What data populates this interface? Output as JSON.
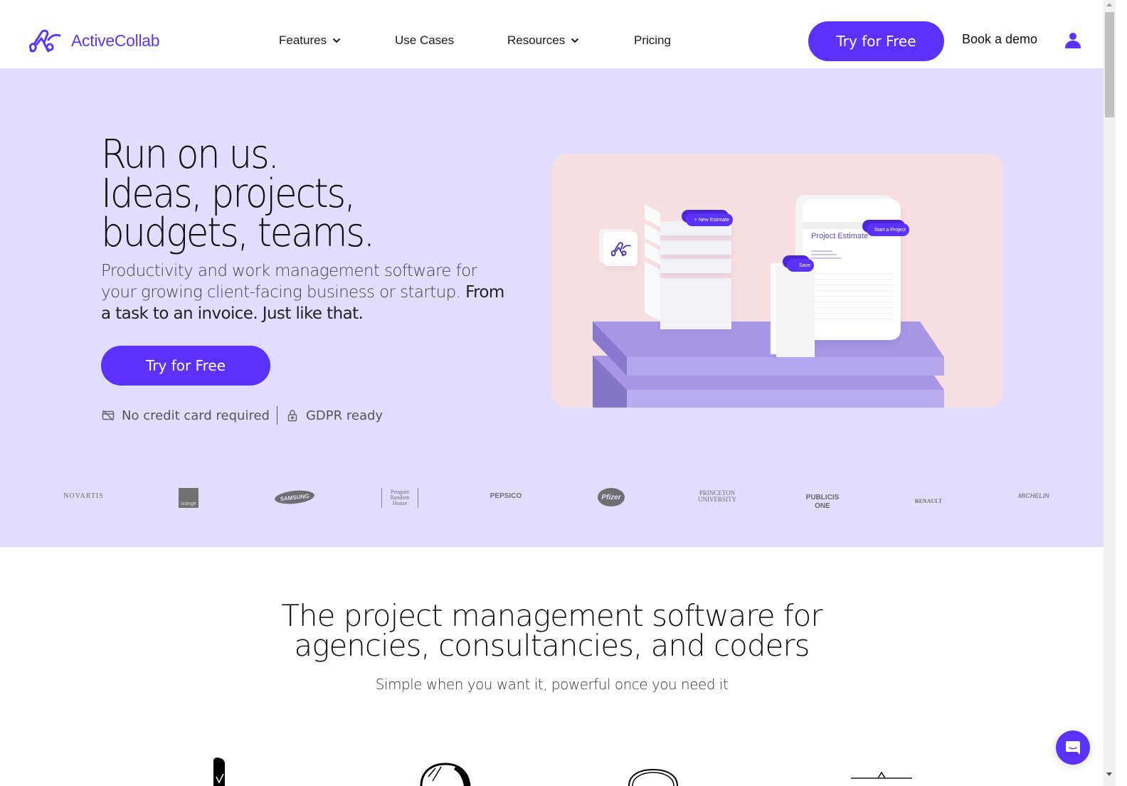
{
  "header": {
    "logo_text": "ActiveCollab",
    "nav": [
      {
        "label": "Features",
        "has_dropdown": true
      },
      {
        "label": "Use Cases",
        "has_dropdown": false
      },
      {
        "label": "Resources",
        "has_dropdown": true
      },
      {
        "label": "Pricing",
        "has_dropdown": false
      }
    ],
    "cta_label": "Try for Free",
    "book_demo_label": "Book a demo",
    "user_icon": "user-icon"
  },
  "hero": {
    "title_lines": [
      "Run on us.",
      "Ideas, projects,",
      "budgets, teams."
    ],
    "subtitle_light": "Productivity and work management software for your growing client-facing business or startup.",
    "subtitle_bold": "From a task to an invoice. Just like that.",
    "cta_label": "Try for Free",
    "badges": [
      {
        "icon": "no-credit-card-icon",
        "label": "No credit card required"
      },
      {
        "icon": "lock-icon",
        "label": "GDPR ready"
      }
    ],
    "illustration": {
      "new_estimate_label": "+ New Estimate",
      "start_project_label": "Start a Project",
      "save_label": "Save",
      "doc_title": "Project Estimate"
    }
  },
  "client_logos": [
    "NOVARTIS",
    "orange",
    "SAMSUNG",
    "Penguin Random House",
    "PEPSICO",
    "Pfizer",
    "PRINCETON UNIVERSITY",
    "PUBLICIS ONE",
    "RENAULT",
    "MICHELIN"
  ],
  "section2": {
    "title_line1": "The project management software for",
    "title_line2": "agencies, consultancies, and coders",
    "subtitle": "Simple when you want it, powerful once you need it"
  },
  "colors": {
    "brand": "#5a32fb",
    "hero_bg": "#e2dcfe",
    "illustration_bg": "#f8e0e2"
  },
  "chat_widget_icon": "chat-icon"
}
